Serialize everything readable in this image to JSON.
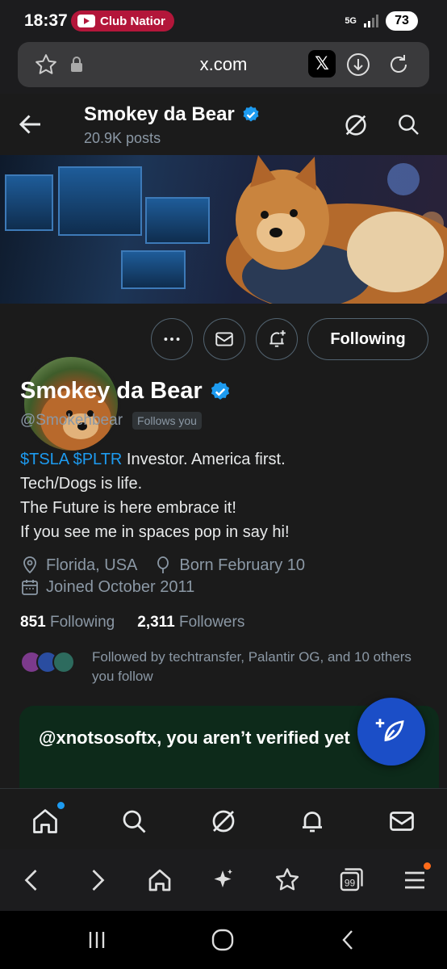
{
  "status_bar": {
    "time": "18:37",
    "notification": "Club Natior",
    "network": "5G",
    "battery": "73"
  },
  "browser": {
    "url": "x.com"
  },
  "profile_header": {
    "name": "Smokey da Bear",
    "posts": "20.9K posts"
  },
  "profile": {
    "name": "Smokey da Bear",
    "handle": "@Smokehbear",
    "follows_you": "Follows you",
    "follow_button": "Following",
    "bio_cashtags": "$TSLA $PLTR",
    "bio_line1_rest": " Investor. America first.",
    "bio_line2": "Tech/Dogs is life.",
    "bio_line3": "The Future is here embrace it!",
    "bio_line4": "If you see me in spaces pop in say hi!",
    "location": "Florida, USA",
    "birthday": "Born February 10",
    "joined": "Joined October 2011",
    "following_count": "851",
    "following_label": "Following",
    "followers_count": "2,311",
    "followers_label": "Followers",
    "followed_by": "Followed by techtransfer, Palantir OG, and 10 others you follow"
  },
  "verify_card": {
    "title": "@xnotsosoftx, you aren’t verified yet"
  },
  "colors": {
    "accent": "#1d9bf0",
    "background": "#1b1b1b",
    "fab": "#1b4ec7",
    "verify_card": "#0d2a1a"
  },
  "icons": {
    "topbar": [
      "back-arrow-icon",
      "grok-icon",
      "search-icon"
    ],
    "actions": [
      "more-icon",
      "message-icon",
      "notification-bell-icon"
    ],
    "app_nav": [
      "home-icon",
      "search-icon",
      "grok-icon",
      "bell-icon",
      "mail-icon"
    ],
    "browser_nav": [
      "back-icon",
      "forward-icon",
      "home-icon",
      "sparkle-icon",
      "bookmark-star-icon",
      "tabs-icon",
      "menu-icon"
    ],
    "system_nav": [
      "recents-icon",
      "home-circle-icon",
      "back-icon"
    ]
  },
  "browser_tabs_count": "99"
}
